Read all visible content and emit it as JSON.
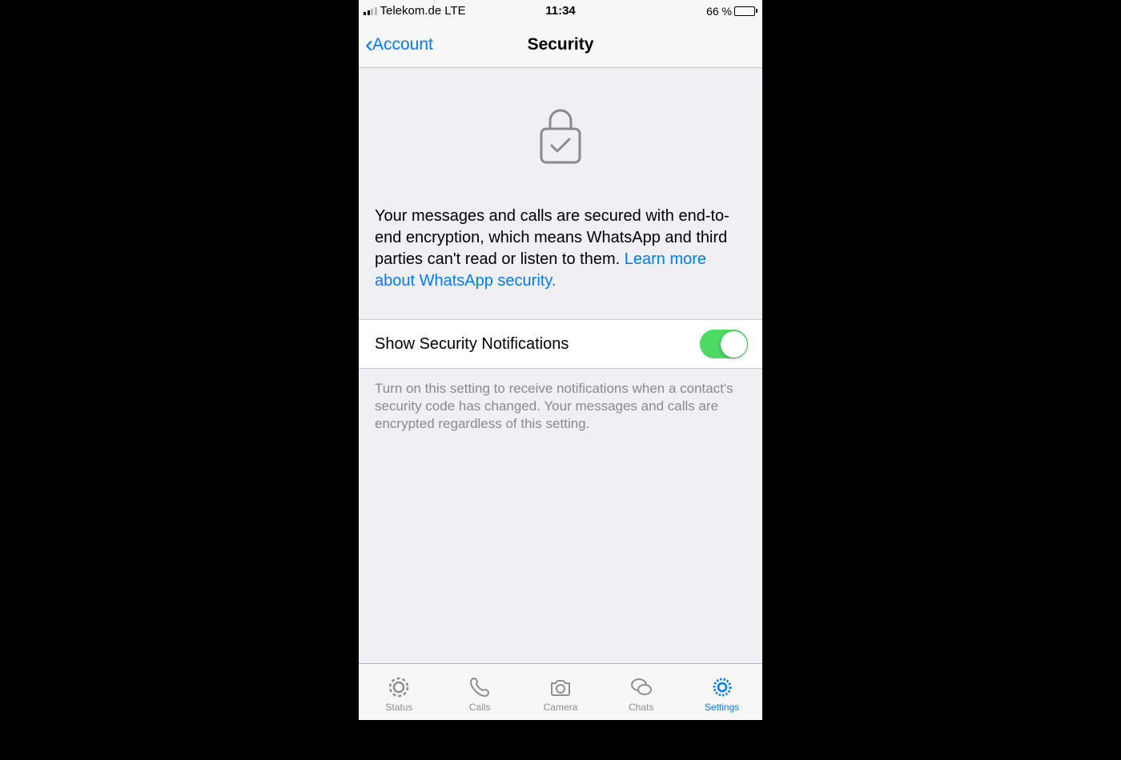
{
  "status_bar": {
    "carrier": "Telekom.de",
    "network": "LTE",
    "time": "11:34",
    "battery_pct": "66 %"
  },
  "nav": {
    "back_label": "Account",
    "title": "Security"
  },
  "hero": {
    "description": "Your messages and calls are secured with end-to-end encryption, which means WhatsApp and third parties can't read or listen to them. ",
    "link_text": "Learn more about WhatsApp security."
  },
  "setting": {
    "label": "Show Security Notifications",
    "footer": "Turn on this setting to receive notifications when a contact's security code has changed. Your messages and calls are encrypted regardless of this setting.",
    "enabled": true
  },
  "tabs": [
    {
      "label": "Status",
      "active": false
    },
    {
      "label": "Calls",
      "active": false
    },
    {
      "label": "Camera",
      "active": false
    },
    {
      "label": "Chats",
      "active": false
    },
    {
      "label": "Settings",
      "active": true
    }
  ],
  "colors": {
    "accent": "#007aff",
    "toggle_on": "#4cd964",
    "bg": "#efeff4"
  }
}
